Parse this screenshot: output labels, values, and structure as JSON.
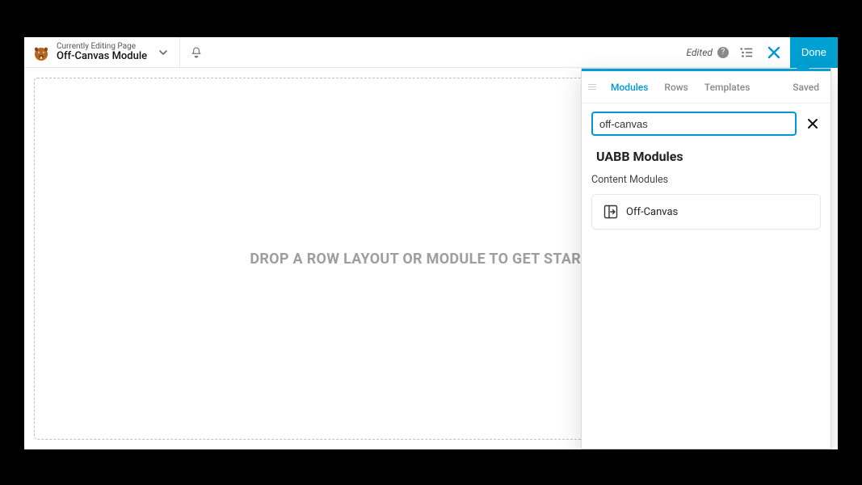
{
  "topbar": {
    "subtitle": "Currently Editing Page",
    "title": "Off-Canvas Module",
    "edited_label": "Edited",
    "done_label": "Done"
  },
  "canvas": {
    "drop_text": "DROP A ROW LAYOUT OR MODULE TO GET STARTED!"
  },
  "panel": {
    "tabs": [
      "Modules",
      "Rows",
      "Templates",
      "Saved"
    ],
    "active_tab_index": 0,
    "search_value": "off-canvas",
    "group_title": "UABB Modules",
    "section_title": "Content Modules",
    "modules": [
      {
        "label": "Off-Canvas"
      }
    ]
  },
  "colors": {
    "accent": "#00A0D2"
  }
}
